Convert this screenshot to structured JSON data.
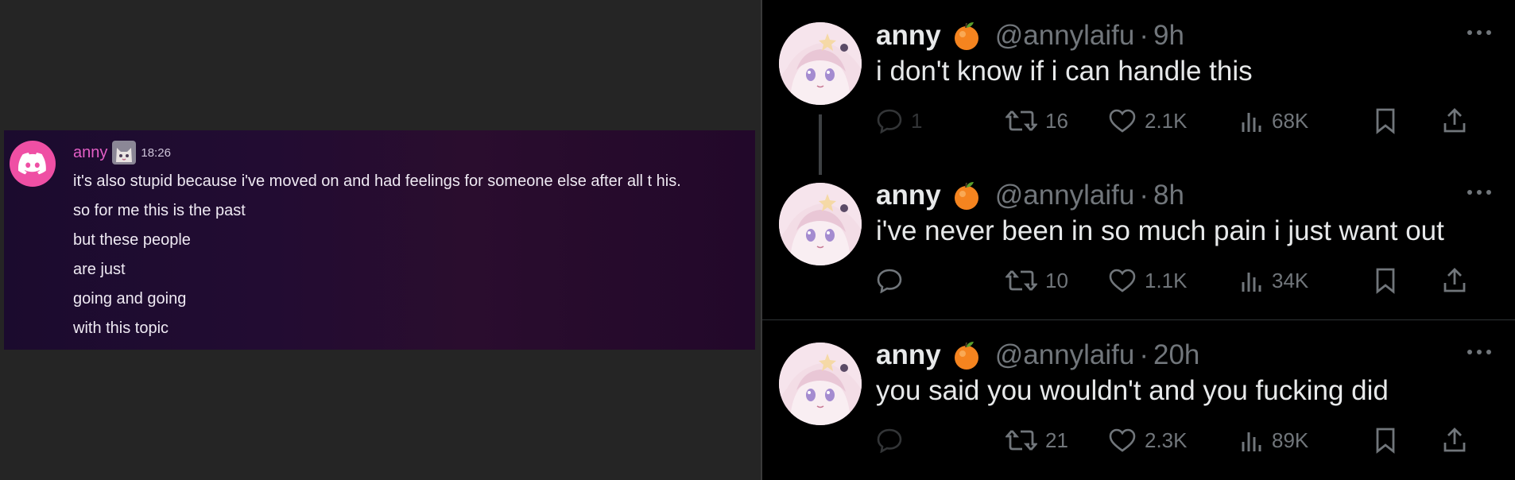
{
  "discord": {
    "username": "anny",
    "timestamp": "18:26",
    "lines": [
      "it's also stupid because i've moved on and had feelings for someone else after all t his.",
      "so for me this is the past",
      "but these people",
      "are just",
      "going and going",
      "with this topic"
    ],
    "colors": {
      "username": "#e45ec6",
      "avatar_bg": "#ef4fa4"
    },
    "icons": {
      "avatar": "discord-logo-icon",
      "badge": "cat-badge-icon"
    }
  },
  "tweets": [
    {
      "name": "anny",
      "emoji": "tangerine-emoji",
      "handle": "@annylaifu",
      "separator": "·",
      "time": "9h",
      "text": "i don't know if i can handle this",
      "replies": "1",
      "retweets": "16",
      "likes": "2.1K",
      "views": "68K"
    },
    {
      "name": "anny",
      "emoji": "tangerine-emoji",
      "handle": "@annylaifu",
      "separator": "·",
      "time": "8h",
      "text": "i've never been in so much pain i just want out",
      "replies": "",
      "retweets": "10",
      "likes": "1.1K",
      "views": "34K"
    },
    {
      "name": "anny",
      "emoji": "tangerine-emoji",
      "handle": "@annylaifu",
      "separator": "·",
      "time": "20h",
      "text": "you said you wouldn't and you fucking did",
      "replies": "",
      "retweets": "21",
      "likes": "2.3K",
      "views": "89K"
    }
  ],
  "colors": {
    "twitter_bg": "#000000",
    "muted": "#71767b",
    "text": "#e7e9ea"
  }
}
